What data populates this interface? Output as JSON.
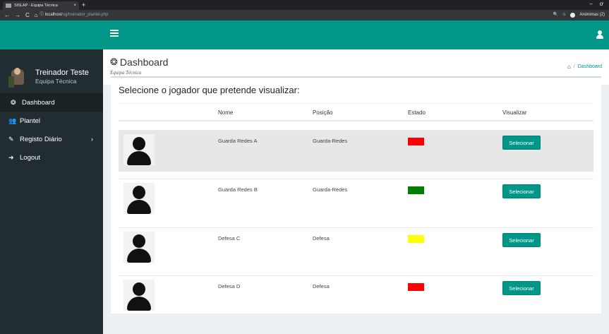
{
  "browser": {
    "tab_title": "SISLAP - Equipa Técnica",
    "tab_close": "×",
    "new_tab": "+",
    "window_min": "–",
    "window_close": "ơ",
    "nav_back": "←",
    "nav_forward": "→",
    "nav_reload": "C",
    "nav_home": "⌂",
    "url_info": "ⓘ",
    "url_host": "localhost",
    "url_path": "/sg/treinador_plantel.php",
    "search_icon": "🔍",
    "star_icon": "☆",
    "profile_label": "Anónimas (2)"
  },
  "sidebar": {
    "user_name": "Treinador Teste",
    "user_role": "Equipa Técnica",
    "items": [
      {
        "label": "Dashboard",
        "icon": "tachometer-icon",
        "glyph": "❂"
      },
      {
        "label": "Plantel",
        "icon": "users-icon",
        "glyph": "👥"
      },
      {
        "label": "Registo Diário",
        "icon": "edit-icon",
        "glyph": "✎",
        "caret": "›"
      },
      {
        "label": "Logout",
        "icon": "sign-out-icon",
        "glyph": "➜"
      }
    ]
  },
  "header": {
    "title": "Dashboard",
    "title_glyph": "❂",
    "subtitle": "Equipa Técnica",
    "breadcrumb_home_glyph": "⌂",
    "breadcrumb_sep": "/",
    "breadcrumb_current": "Dashboard"
  },
  "main": {
    "box_title": "Selecione o jogador que pretende visualizar:",
    "columns": [
      "Nome",
      "Posição",
      "Estado",
      "Visualizar"
    ],
    "players": [
      {
        "name": "Guarda Redes A",
        "position": "Guarda-Redes",
        "status_color": "#ff0000",
        "button": "Selecionar"
      },
      {
        "name": "Guarda Redes B",
        "position": "Guarda-Redes",
        "status_color": "#008000",
        "button": "Selecionar"
      },
      {
        "name": "Defesa C",
        "position": "Defesa",
        "status_color": "#ffff00",
        "button": "Selecionar"
      },
      {
        "name": "Defesa D",
        "position": "Defesa",
        "status_color": "#ff0000",
        "button": "Selecionar"
      }
    ]
  },
  "colors": {
    "accent": "#009688",
    "sidebar_bg": "#222d32",
    "highlight_row": "#e7e7e7"
  }
}
